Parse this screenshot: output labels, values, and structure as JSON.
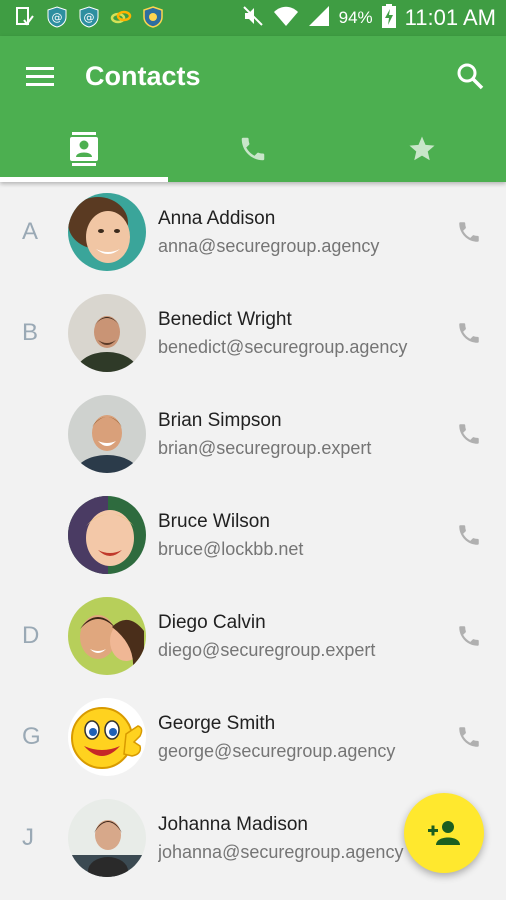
{
  "status_bar": {
    "battery": "94%",
    "time": "11:01 AM",
    "icons": [
      "download-done-icon",
      "secure-at-icon",
      "secure-at-icon",
      "link-icon",
      "shield-icon",
      "mute-icon",
      "wifi-icon",
      "signal-icon",
      "battery-charging-icon"
    ]
  },
  "app_bar": {
    "title": "Contacts",
    "tabs": [
      {
        "icon": "contacts-icon",
        "selected": true
      },
      {
        "icon": "phone-icon",
        "selected": false
      },
      {
        "icon": "star-icon",
        "selected": false
      }
    ]
  },
  "contacts": [
    {
      "letter": "A",
      "name": "Anna Addison",
      "email": "anna@securegroup.agency"
    },
    {
      "letter": "B",
      "name": "Benedict Wright",
      "email": "benedict@securegroup.agency"
    },
    {
      "letter": "",
      "name": "Brian Simpson",
      "email": "brian@securegroup.expert"
    },
    {
      "letter": "",
      "name": "Bruce Wilson",
      "email": "bruce@lockbb.net"
    },
    {
      "letter": "D",
      "name": "Diego Calvin",
      "email": "diego@securegroup.expert"
    },
    {
      "letter": "G",
      "name": "George Smith",
      "email": "george@securegroup.agency"
    },
    {
      "letter": "J",
      "name": "Johanna Madison",
      "email": "johanna@securegroup.agency"
    }
  ],
  "fab": {
    "icon": "add-contact-icon"
  },
  "colors": {
    "primary": "#4caf50",
    "status_bar": "#3f9d43",
    "fab": "#ffe82e",
    "fab_icon": "#1b5e20"
  }
}
